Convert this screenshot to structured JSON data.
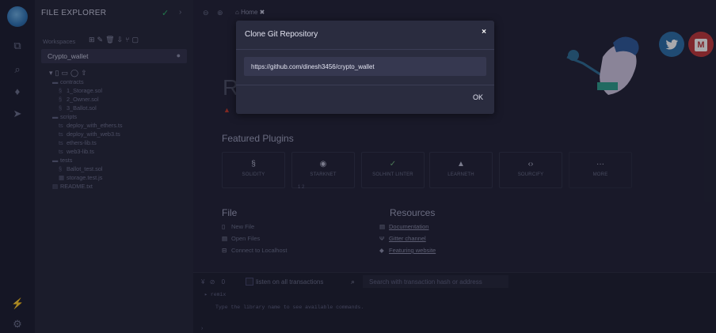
{
  "explorer": {
    "title": "FILE EXPLORER",
    "workspaces_label": "Workspaces",
    "workspace_selected": "Crypto_wallet",
    "tree": [
      {
        "label": "contracts",
        "type": "folder",
        "depth": 1,
        "icon": "folder-icon"
      },
      {
        "label": "1_Storage.sol",
        "type": "file",
        "depth": 2,
        "icon": "solidity-file-icon"
      },
      {
        "label": "2_Owner.sol",
        "type": "file",
        "depth": 2,
        "icon": "solidity-file-icon"
      },
      {
        "label": "3_Ballot.sol",
        "type": "file",
        "depth": 2,
        "icon": "solidity-file-icon"
      },
      {
        "label": "scripts",
        "type": "folder",
        "depth": 1,
        "icon": "folder-icon"
      },
      {
        "label": "deploy_with_ethers.ts",
        "type": "file",
        "depth": 2,
        "icon": "ts-file-icon"
      },
      {
        "label": "deploy_with_web3.ts",
        "type": "file",
        "depth": 2,
        "icon": "ts-file-icon"
      },
      {
        "label": "ethers-lib.ts",
        "type": "file",
        "depth": 2,
        "icon": "ts-file-icon"
      },
      {
        "label": "web3-lib.ts",
        "type": "file",
        "depth": 2,
        "icon": "ts-file-icon"
      },
      {
        "label": "tests",
        "type": "folder",
        "depth": 1,
        "icon": "folder-icon"
      },
      {
        "label": "Ballot_test.sol",
        "type": "file",
        "depth": 2,
        "icon": "solidity-file-icon"
      },
      {
        "label": "storage.test.js",
        "type": "file",
        "depth": 2,
        "icon": "js-file-icon"
      },
      {
        "label": "README.txt",
        "type": "file",
        "depth": 1,
        "icon": "text-file-icon"
      }
    ]
  },
  "tabs": {
    "home_label": "Home"
  },
  "home": {
    "title_partial": "R",
    "featured_title": "Featured Plugins",
    "plugins": [
      {
        "label": "SOLIDITY",
        "icon": "solidity-icon"
      },
      {
        "label": "STARKNET",
        "icon": "starknet-icon"
      },
      {
        "label": "SOLHINT LINTER",
        "icon": "solhint-icon"
      },
      {
        "label": "LEARNETH",
        "icon": "learneth-icon"
      },
      {
        "label": "SOURCIFY",
        "icon": "sourcify-icon"
      },
      {
        "label": "MORE",
        "icon": "more-icon"
      }
    ],
    "file_section": {
      "title": "File",
      "items": [
        {
          "label": "New File",
          "icon": "new-file-icon"
        },
        {
          "label": "Open Files",
          "icon": "open-files-icon"
        },
        {
          "label": "Connect to Localhost",
          "icon": "localhost-icon"
        }
      ]
    },
    "resources_section": {
      "title": "Resources",
      "items": [
        {
          "label": "Documentation",
          "icon": "documentation-icon"
        },
        {
          "label": "Gitter channel",
          "icon": "gitter-icon"
        },
        {
          "label": "Featuring website",
          "icon": "website-icon"
        }
      ]
    }
  },
  "terminal": {
    "count": "0",
    "listen_label": "listen on all transactions",
    "search_placeholder": "Search with transaction hash or address",
    "remix_line": "remix",
    "hint_line": "Type the library name to see available commands."
  },
  "modal": {
    "title": "Clone Git Repository",
    "url_value": "https://github.com/dinesh3456/crypto_wallet",
    "ok_label": "OK",
    "close_glyph": "×"
  },
  "social": {
    "twitter_glyph": "t",
    "medium_glyph": "M",
    "twitter_color": "#2d6fa8",
    "medium_color": "#c0383b"
  }
}
